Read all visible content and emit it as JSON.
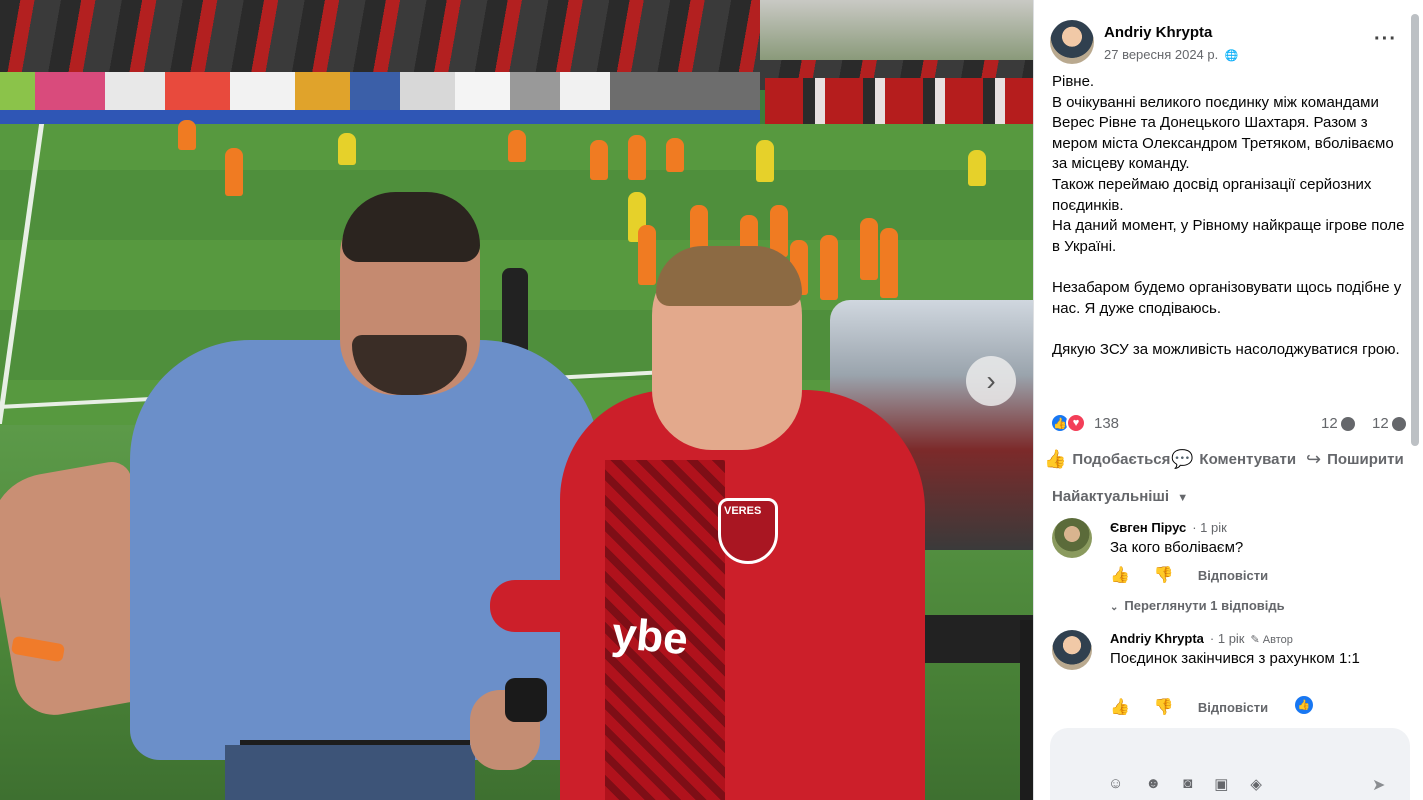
{
  "viewer": {
    "next_icon": "chevron-right-icon",
    "next_label": "›",
    "photo_shirt_text": "ybe",
    "photo_crest_text": "VERES"
  },
  "post": {
    "author": "Andriy Khrypta",
    "date": "27 вересня 2024 р.",
    "privacy_glyph": "🌐",
    "more_label": "···",
    "text": "Рівне.\nВ очікуванні великого поєдинку між командами Верес Рівне та Донецького Шахтаря. Разом з мером міста Олександром Третяком, вболіваємо за місцеву команду.\nТакож переймаю досвід організації серйозних поєдинків.\nНа даний момент, у Рівному найкраще ігрове поле в Україні.\n\nНезабаром будемо організовувати щось подібне у нас. Я дуже сподіваюсь.\n\nДякую ЗСУ за можливість насолоджуватися грою.",
    "reaction_count": "138",
    "comment_count": "12",
    "share_count": "12"
  },
  "actions": {
    "like": "Подобається",
    "comment": "Коментувати",
    "share": "Поширити"
  },
  "comments_sort": "Найактуальніші",
  "comments": [
    {
      "author": "Євген Пірус",
      "time": "· 1 рік",
      "text": "За кого вболіваєм?",
      "reply": "Відповісти"
    },
    {
      "author": "Andriy Khrypta",
      "time": "· 1 рік",
      "badge": "✎ Автор",
      "text": "Поєдинок закінчився з рахунком 1:1",
      "reply": "Відповісти"
    }
  ],
  "view_replies": "Переглянути 1 відповідь",
  "colors": {
    "facebook_blue": "#1877f2",
    "love_red": "#f33e58",
    "secondary_text": "#65676b",
    "jacket_red": "#cc1f2a"
  }
}
